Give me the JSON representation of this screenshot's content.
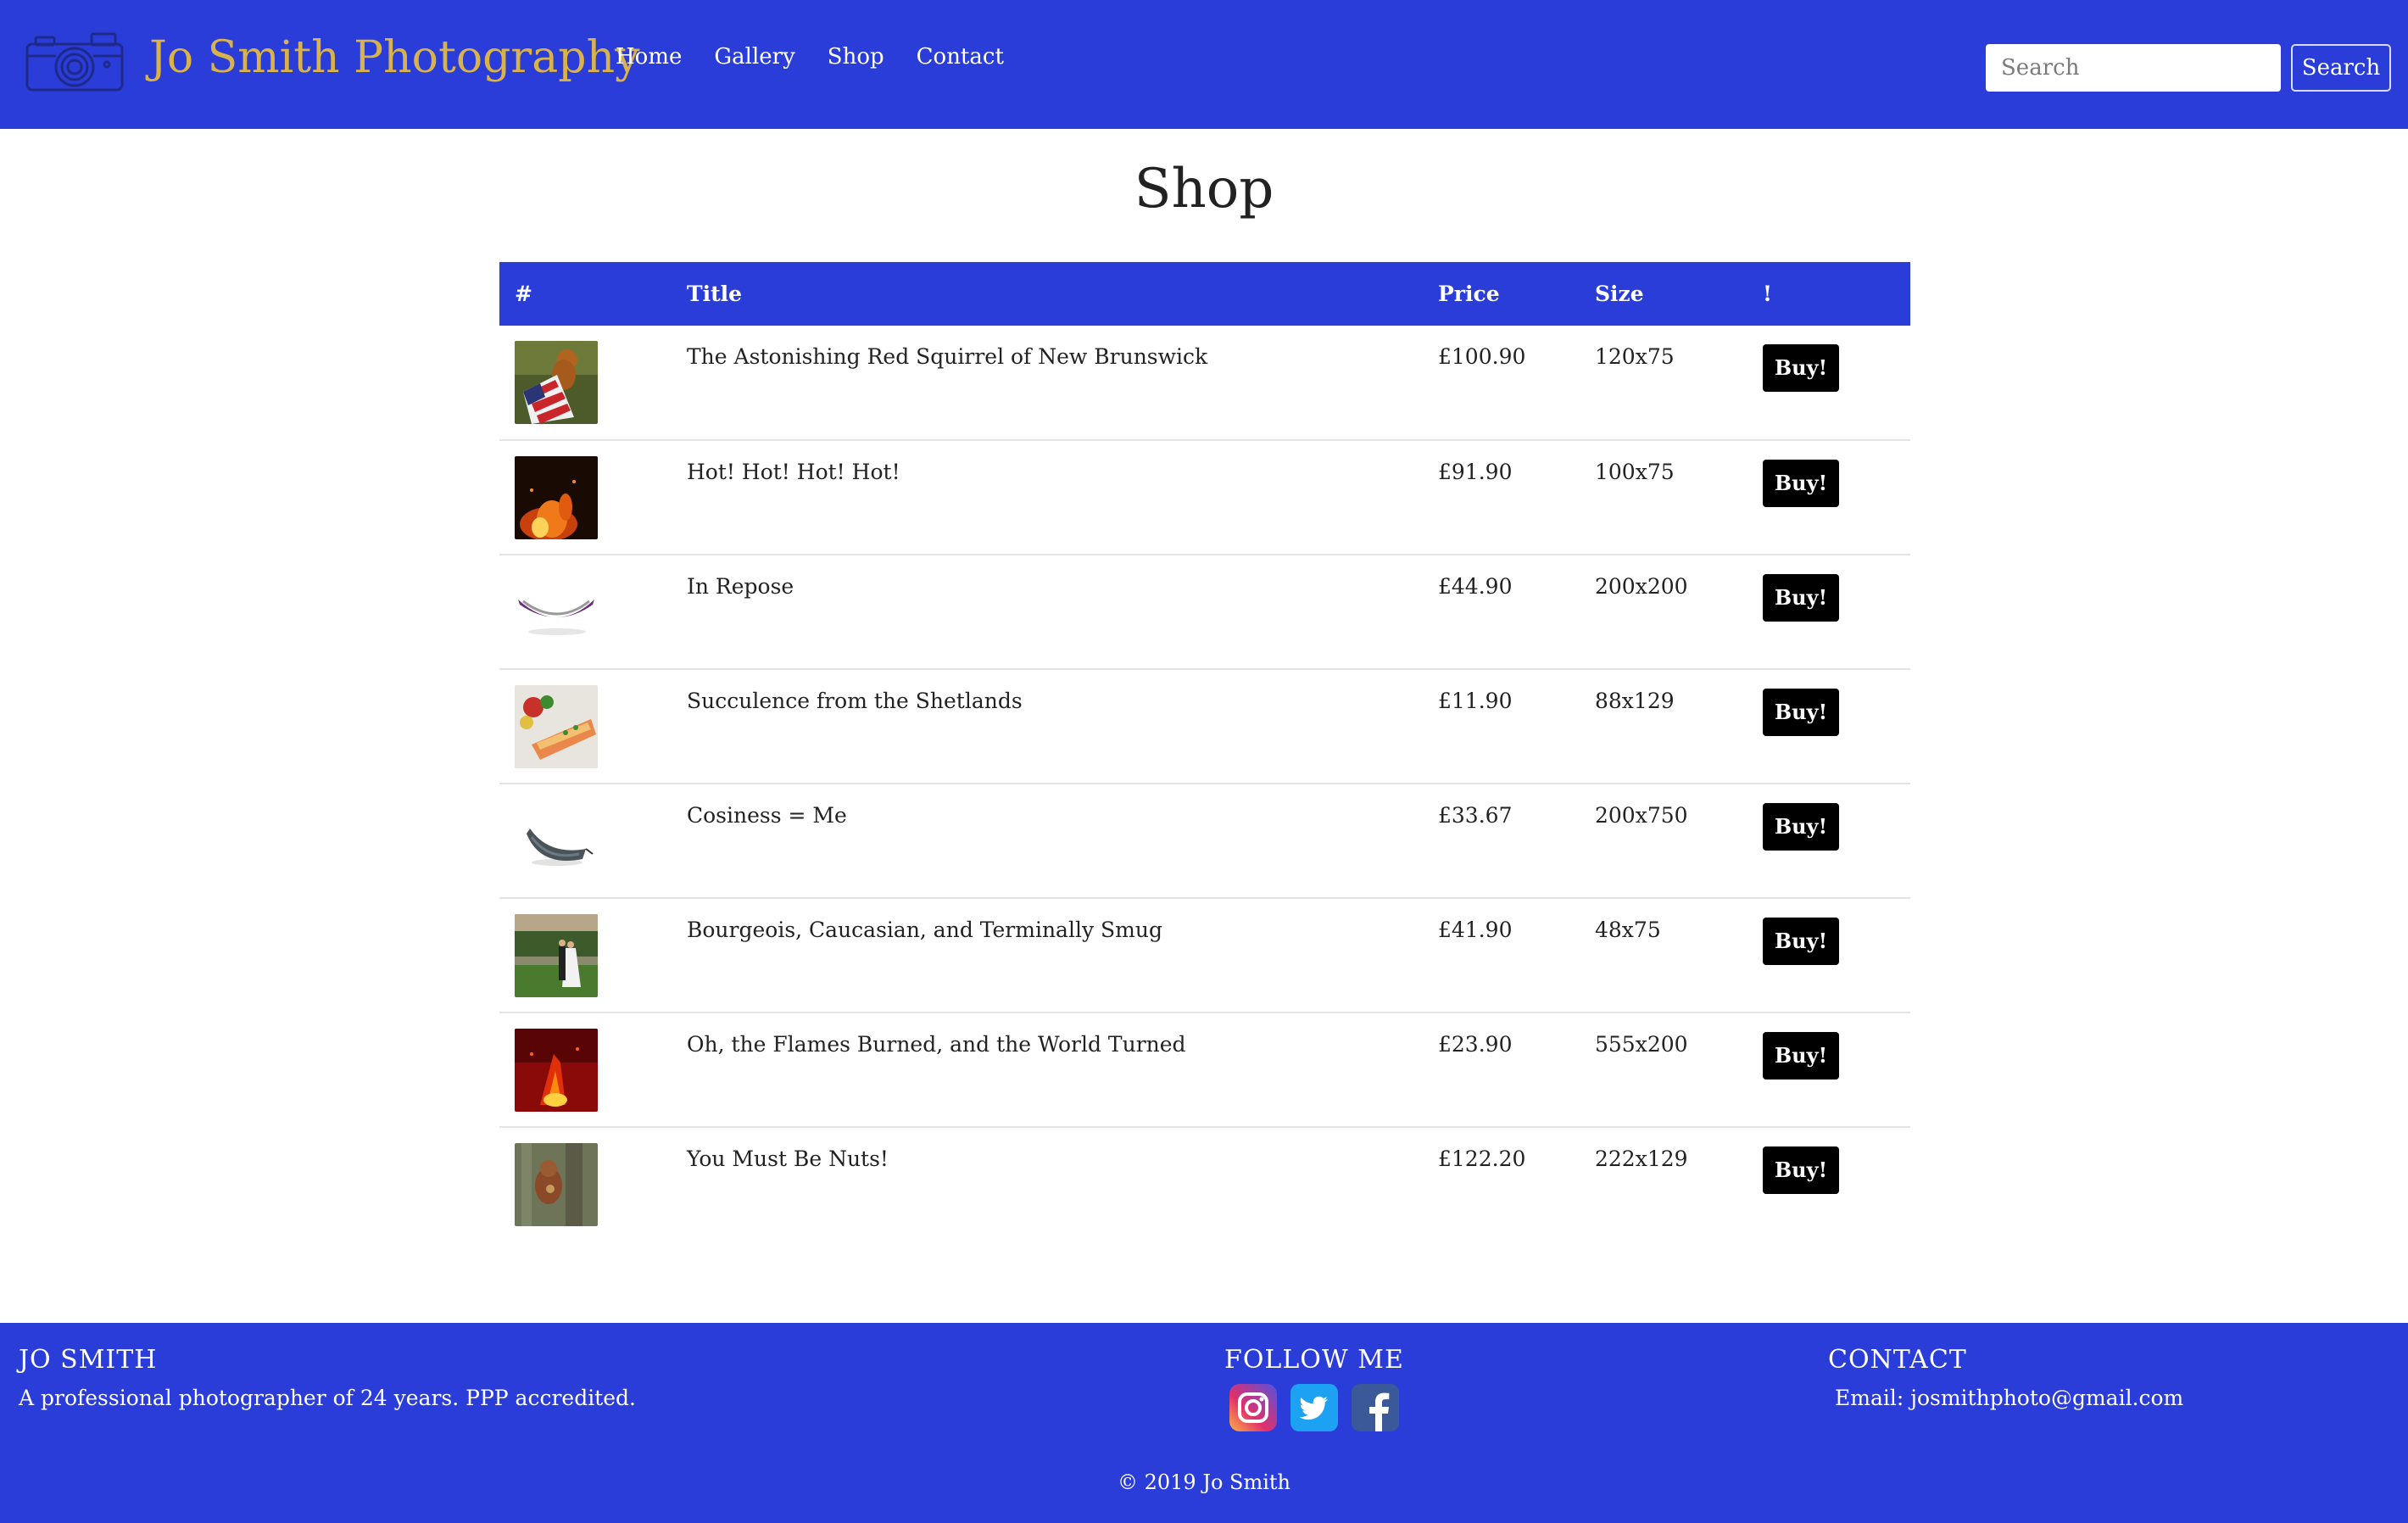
{
  "navbar": {
    "brand": "Jo Smith Photography",
    "links": [
      "Home",
      "Gallery",
      "Shop",
      "Contact"
    ],
    "search_placeholder": "Search",
    "search_button": "Search",
    "colors": {
      "bar": "#2a3dd9",
      "brand_text": "#d9b34a"
    }
  },
  "main": {
    "title": "Shop",
    "table": {
      "headers": [
        "#",
        "Title",
        "Price",
        "Size",
        "!"
      ],
      "rows": [
        {
          "thumb": "red-squirrel-with-flag-photo",
          "title": "The Astonishing Red Squirrel of New Brunswick",
          "price": "£100.90",
          "size": "120x75",
          "buy": "Buy!"
        },
        {
          "thumb": "fire-photo",
          "title": "Hot! Hot! Hot! Hot!",
          "price": "£91.90",
          "size": "100x75",
          "buy": "Buy!"
        },
        {
          "thumb": "purple-hammock-photo",
          "title": "In Repose",
          "price": "£44.90",
          "size": "200x200",
          "buy": "Buy!"
        },
        {
          "thumb": "salmon-dish-photo",
          "title": "Succulence from the Shetlands",
          "price": "£11.90",
          "size": "88x129",
          "buy": "Buy!"
        },
        {
          "thumb": "grey-hammock-photo",
          "title": "Cosiness = Me",
          "price": "£33.67",
          "size": "200x750",
          "buy": "Buy!"
        },
        {
          "thumb": "wedding-couple-photo",
          "title": "Bourgeois, Caucasian, and Terminally Smug",
          "price": "£41.90",
          "size": "48x75",
          "buy": "Buy!"
        },
        {
          "thumb": "bonfire-photo",
          "title": "Oh, the Flames Burned, and the World Turned",
          "price": "£23.90",
          "size": "555x200",
          "buy": "Buy!"
        },
        {
          "thumb": "squirrel-with-nut-photo",
          "title": "You Must Be Nuts!",
          "price": "£122.20",
          "size": "222x129",
          "buy": "Buy!"
        }
      ]
    }
  },
  "footer": {
    "about_heading": "JO SMITH",
    "about_text": "A professional photographer of 24 years. PPP accredited.",
    "follow_heading": "FOLLOW ME",
    "social_icons": [
      "instagram-icon",
      "twitter-icon",
      "facebook-icon"
    ],
    "contact_heading": "CONTACT",
    "contact_text": "Email: josmithphoto@gmail.com",
    "copyright": "© 2019 Jo Smith"
  }
}
